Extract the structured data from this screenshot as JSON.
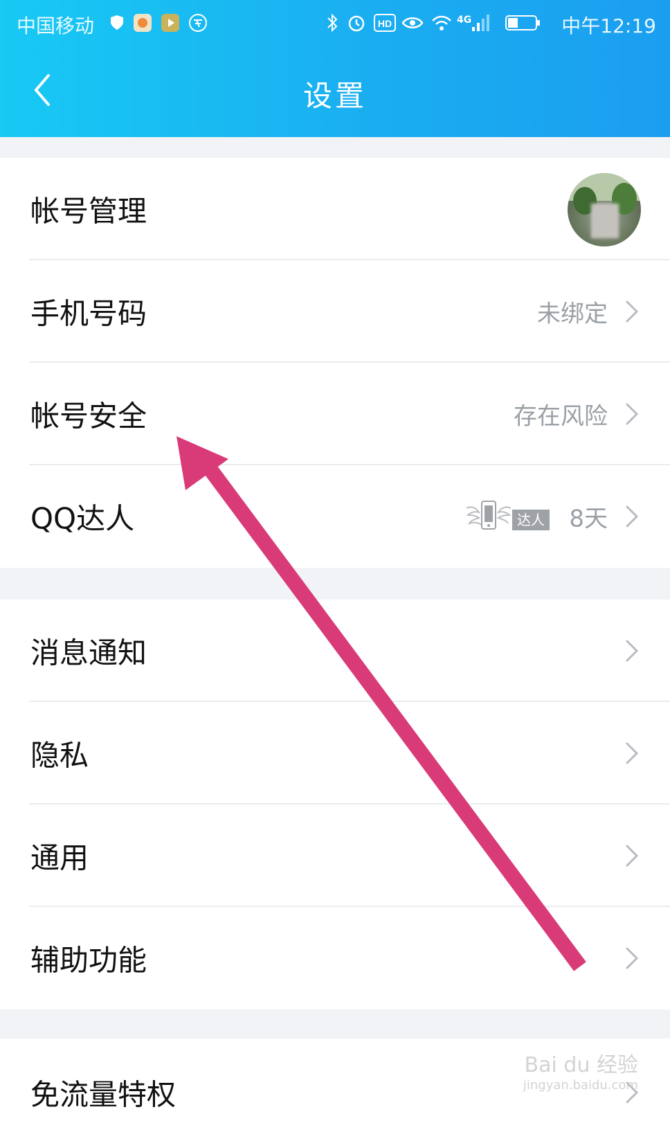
{
  "status_bar": {
    "carrier": "中国移动",
    "network": "4G",
    "time": "中午12:19"
  },
  "header": {
    "title": "设置"
  },
  "group1": [
    {
      "label": "帐号管理"
    },
    {
      "label": "手机号码",
      "value": "未绑定"
    },
    {
      "label": "帐号安全",
      "value": "存在风险"
    },
    {
      "label": "QQ达人",
      "badge": "达人",
      "value": "8天"
    }
  ],
  "group2": [
    {
      "label": "消息通知"
    },
    {
      "label": "隐私"
    },
    {
      "label": "通用"
    },
    {
      "label": "辅助功能"
    }
  ],
  "group3": [
    {
      "label": "免流量特权"
    }
  ],
  "watermark": {
    "brand": "Bai du 经验",
    "url": "jingyan.baidu.com"
  },
  "colors": {
    "header_start": "#18c9f4",
    "header_end": "#1b9ef0",
    "annotation_arrow": "#d93a78"
  }
}
